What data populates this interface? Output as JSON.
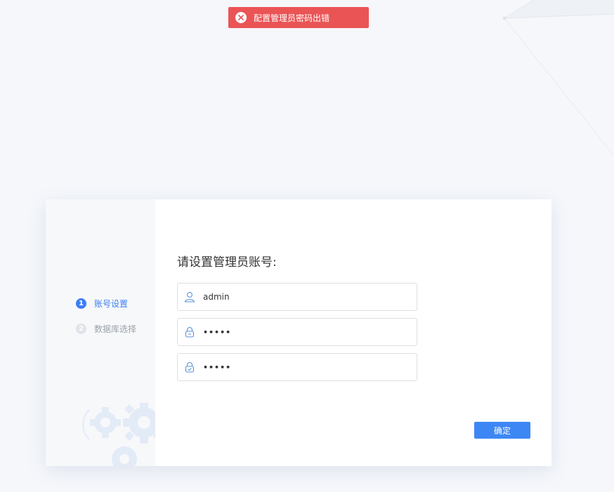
{
  "toast": {
    "message": "配置管理员密码出错",
    "type": "error"
  },
  "steps": [
    {
      "number": "1",
      "label": "账号设置",
      "state": "active"
    },
    {
      "number": "2",
      "label": "数据库选择",
      "state": "inactive"
    }
  ],
  "form": {
    "title": "请设置管理员账号:",
    "username": {
      "value": "admin",
      "icon": "user-icon"
    },
    "password": {
      "value": "•••••",
      "icon": "lock-icon"
    },
    "confirm_password": {
      "value": "•••••",
      "icon": "lock-check-icon"
    },
    "confirm_label": "确定"
  },
  "colors": {
    "accent": "#3d7ef5",
    "error": "#ea5455",
    "background": "#f5f7fb"
  }
}
